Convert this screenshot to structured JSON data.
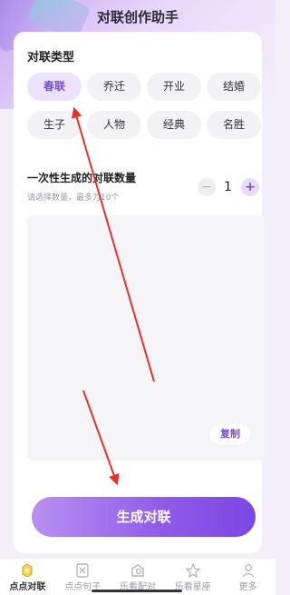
{
  "header": {
    "title": "对联创作助手"
  },
  "type_section": {
    "title": "对联类型",
    "options": [
      "春联",
      "乔迁",
      "开业",
      "结婚",
      "生子",
      "人物",
      "经典",
      "名胜"
    ],
    "selected": "春联"
  },
  "quantity": {
    "title": "一次性生成的对联数量",
    "hint": "请选择数量，最多为10个",
    "value": "1",
    "minus": "−",
    "plus": "+"
  },
  "result": {
    "copy_label": "复制"
  },
  "generate_label": "生成对联",
  "bottom_nav": {
    "items": [
      {
        "label": "点点对联",
        "icon": "couplet-icon",
        "active": true
      },
      {
        "label": "点点句子",
        "icon": "sentence-icon",
        "active": false
      },
      {
        "label": "乐看配对",
        "icon": "match-icon",
        "active": false
      },
      {
        "label": "乐看星座",
        "icon": "star-icon",
        "active": false
      },
      {
        "label": "更多",
        "icon": "more-icon",
        "active": false
      }
    ]
  },
  "colors": {
    "accent": "#7b4bd6",
    "annotation_arrow": "#e8312c"
  }
}
